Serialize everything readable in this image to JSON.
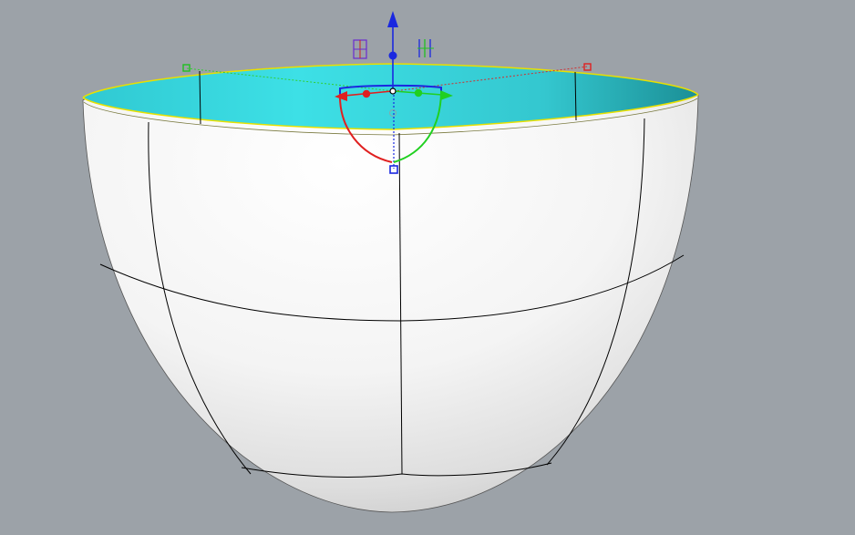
{
  "viewport": {
    "background": "#9ca2a8",
    "selection_color": "#f0e000"
  },
  "bowl": {
    "outer_fill": "#ffffff",
    "inner_fill": "#3ad8e0",
    "inner_shade": "#1fa6ad",
    "isocurve_color": "#000000"
  },
  "gizmo": {
    "x_axis_color": "#e02020",
    "y_axis_color": "#20d020",
    "z_axis_color": "#1a28e0",
    "icons": [
      "plane-xz-icon",
      "plane-yz-icon"
    ]
  }
}
